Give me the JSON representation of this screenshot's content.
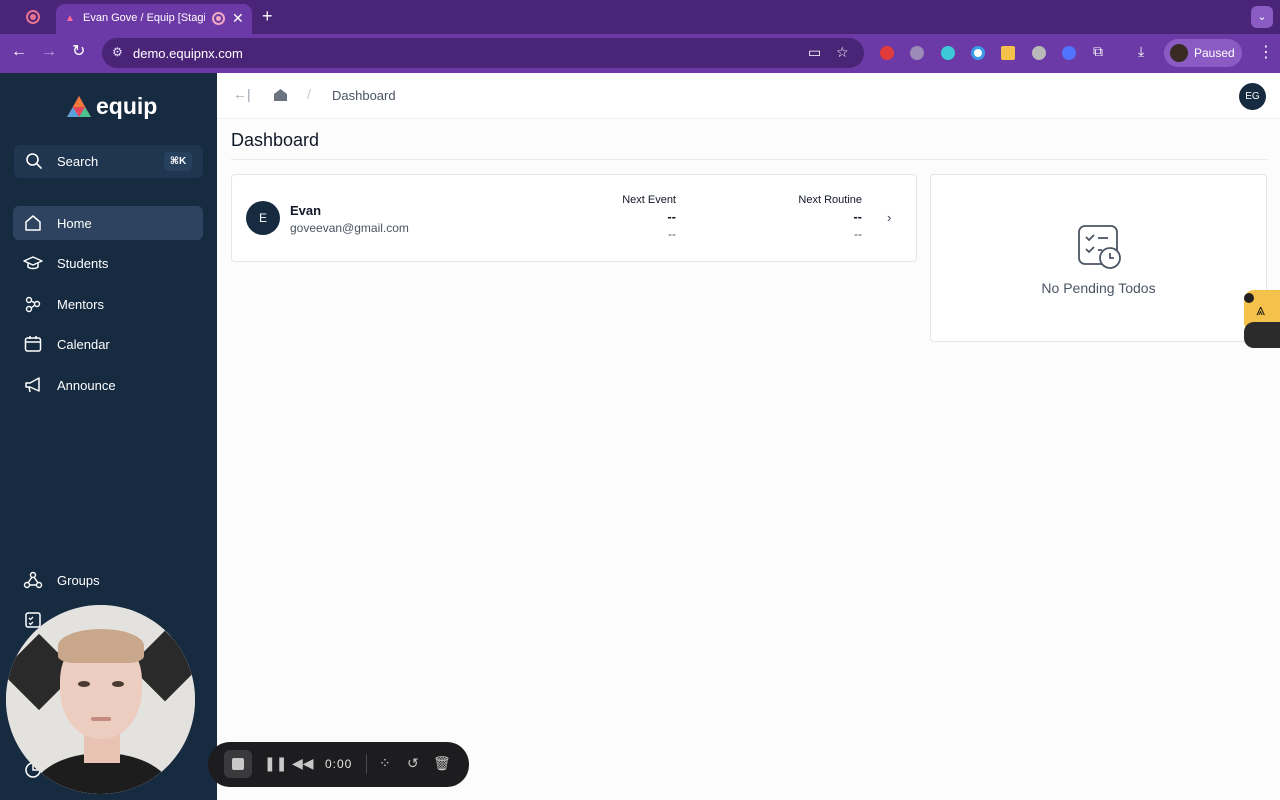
{
  "browser": {
    "tab_title": "Evan Gove / Equip [Staging]",
    "url": "demo.equipnx.com",
    "profile_status": "Paused",
    "extension_colors": [
      "#e23b3b",
      "#9c8bb8",
      "#3ccad9",
      "#3a9be8",
      "#f4c24a",
      "#b9b9b9",
      "#4f72ff"
    ]
  },
  "sidebar": {
    "logo_text": "equip",
    "search": {
      "label": "Search",
      "shortcut": "⌘K"
    },
    "items": [
      {
        "label": "Home",
        "icon": "home-icon",
        "active": true
      },
      {
        "label": "Students",
        "icon": "graduation-cap-icon"
      },
      {
        "label": "Mentors",
        "icon": "users-icon"
      },
      {
        "label": "Calendar",
        "icon": "calendar-icon"
      },
      {
        "label": "Announce",
        "icon": "megaphone-icon"
      }
    ],
    "bottom_items": [
      {
        "label": "Groups",
        "icon": "groups-icon"
      }
    ]
  },
  "header": {
    "breadcrumb": [
      "Dashboard"
    ],
    "avatar_initials": "EG"
  },
  "main": {
    "title": "Dashboard",
    "user_card": {
      "initial": "E",
      "name": "Evan",
      "email": "goveevan@gmail.com",
      "next_event_label": "Next Event",
      "next_event_value": "--",
      "next_event_sub": "--",
      "next_routine_label": "Next Routine",
      "next_routine_value": "--",
      "next_routine_sub": "--"
    },
    "todos": {
      "empty_text": "No Pending Todos"
    }
  },
  "recorder": {
    "time": "0:00"
  },
  "colors": {
    "sidebar_bg": "#162a40",
    "browser_accent": "#6c3aa6",
    "brand_red": "#e8445a"
  }
}
